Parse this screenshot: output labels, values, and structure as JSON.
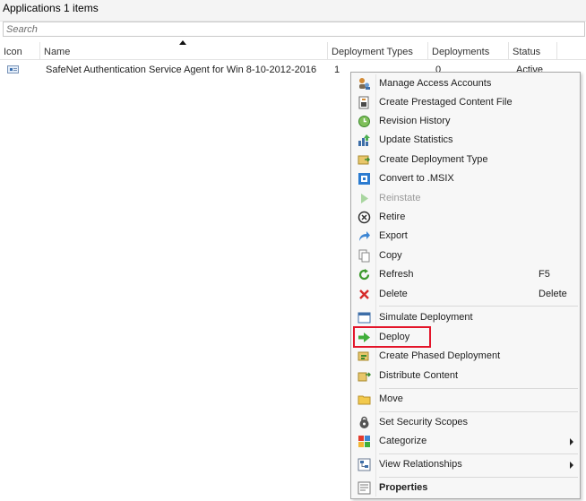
{
  "header": {
    "title": "Applications 1 items"
  },
  "search": {
    "placeholder": "Search"
  },
  "columns": [
    "Icon",
    "Name",
    "Deployment Types",
    "Deployments",
    "Status"
  ],
  "row": {
    "name": "SafeNet Authentication Service Agent for Win 8-10-2012-2016",
    "deployment_types": "1",
    "deployments": "0",
    "status": "Active"
  },
  "context_menu": {
    "items": [
      {
        "label": "Manage Access Accounts",
        "icon": "access-accounts-icon"
      },
      {
        "label": "Create Prestaged Content File",
        "icon": "prestaged-content-icon"
      },
      {
        "label": "Revision History",
        "icon": "revision-history-icon"
      },
      {
        "label": "Update Statistics",
        "icon": "update-statistics-icon"
      },
      {
        "label": "Create Deployment Type",
        "icon": "deployment-type-icon"
      },
      {
        "label": "Convert to .MSIX",
        "icon": "msix-icon"
      },
      {
        "label": "Reinstate",
        "icon": "reinstate-icon",
        "disabled": true
      },
      {
        "label": "Retire",
        "icon": "retire-icon"
      },
      {
        "label": "Export",
        "icon": "export-icon"
      },
      {
        "label": "Copy",
        "icon": "copy-icon"
      },
      {
        "label": "Refresh",
        "icon": "refresh-icon",
        "shortcut": "F5"
      },
      {
        "label": "Delete",
        "icon": "delete-icon",
        "shortcut": "Delete"
      },
      {
        "label": "Simulate Deployment",
        "icon": "simulate-deployment-icon"
      },
      {
        "label": "Deploy",
        "icon": "deploy-icon"
      },
      {
        "label": "Create Phased Deployment",
        "icon": "phased-deployment-icon"
      },
      {
        "label": "Distribute Content",
        "icon": "distribute-content-icon"
      },
      {
        "label": "Move",
        "icon": "move-folder-icon"
      },
      {
        "label": "Set Security Scopes",
        "icon": "security-scopes-icon"
      },
      {
        "label": "Categorize",
        "icon": "categorize-icon",
        "submenu": true
      },
      {
        "label": "View Relationships",
        "icon": "relationships-icon",
        "submenu": true
      },
      {
        "label": "Properties",
        "icon": "properties-icon",
        "bold": true
      }
    ]
  },
  "colors": {
    "highlight_border": "#e3152a",
    "menu_background": "#f7f7f7"
  }
}
